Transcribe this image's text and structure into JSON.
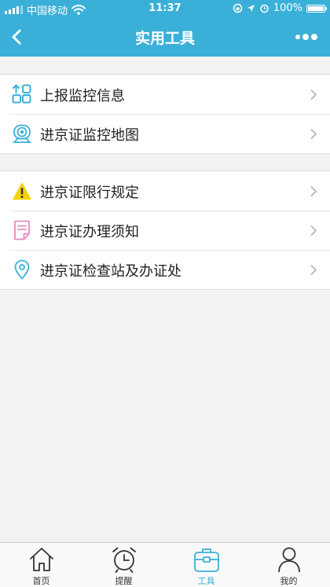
{
  "status_bar": {
    "carrier": "中国移动",
    "time": "11:37",
    "battery": "100%",
    "battery_level": 1.0
  },
  "header": {
    "title": "实用工具",
    "back_icon": "back-chevron-icon",
    "more_icon": "more-dots-icon"
  },
  "groups": [
    {
      "items": [
        {
          "label": "上报监控信息",
          "icon": "report-grid-icon"
        },
        {
          "label": "进京证监控地图",
          "icon": "camera-icon"
        }
      ]
    },
    {
      "items": [
        {
          "label": "进京证限行规定",
          "icon": "warning-icon"
        },
        {
          "label": "进京证办理须知",
          "icon": "notice-document-icon"
        },
        {
          "label": "进京证检查站及办证处",
          "icon": "location-pin-icon"
        }
      ]
    }
  ],
  "tabbar": {
    "active": "工具",
    "tabs": [
      {
        "label": "首页",
        "icon": "home-icon"
      },
      {
        "label": "提醒",
        "icon": "alarm-clock-icon"
      },
      {
        "label": "工具",
        "icon": "toolbox-icon"
      },
      {
        "label": "我的",
        "icon": "user-icon"
      }
    ]
  },
  "colors": {
    "accent": "#3ab0d8",
    "background": "#f2f2f2",
    "warning": "#f5d400",
    "notice": "#e98bc0"
  }
}
